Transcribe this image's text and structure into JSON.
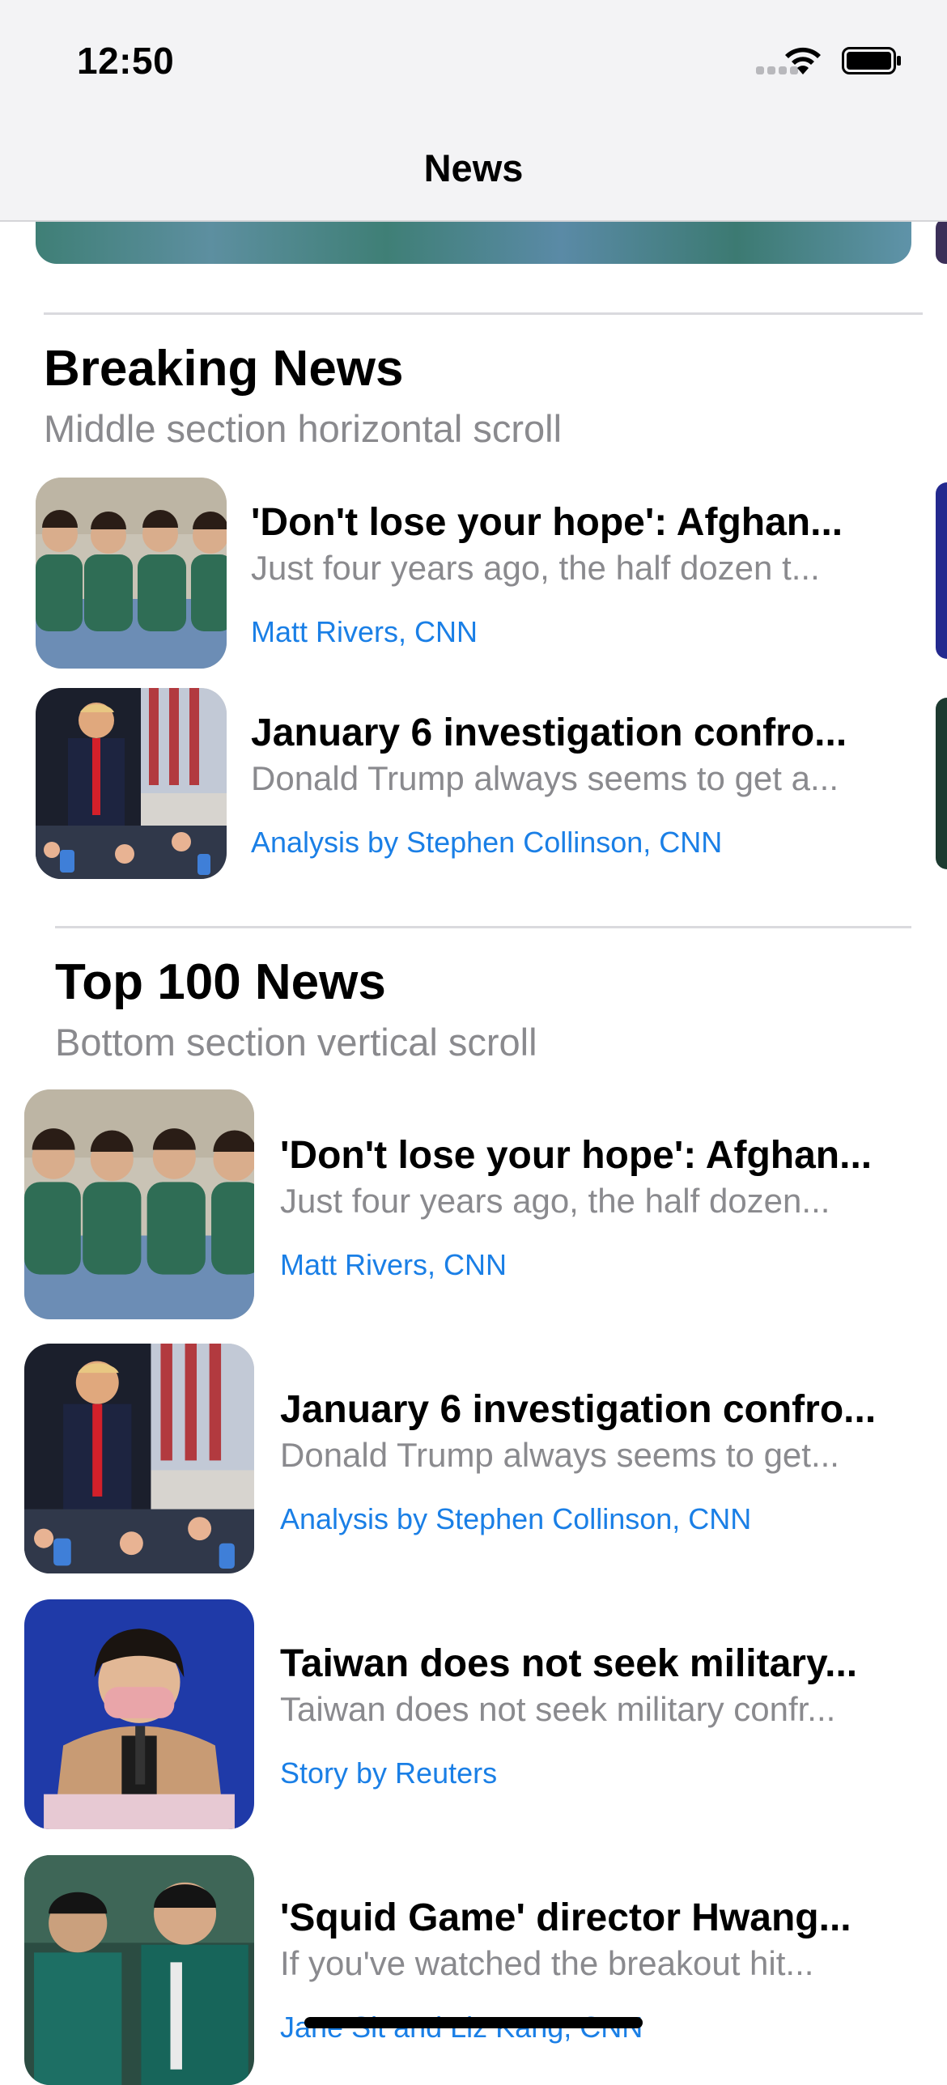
{
  "status_bar": {
    "time": "12:50"
  },
  "nav": {
    "title": "News"
  },
  "breaking": {
    "title": "Breaking News",
    "subtitle": "Middle section horizontal scroll",
    "items": [
      {
        "title": "'Don't lose your hope': Afghan...",
        "description": "Just four years ago, the half dozen t...",
        "author": "Matt Rivers, CNN",
        "image": "afghan-girls-photo"
      },
      {
        "title": "January 6 investigation confro...",
        "description": "Donald Trump always seems to get a...",
        "author": "Analysis by Stephen Collinson, CNN",
        "image": "trump-rally-photo"
      }
    ]
  },
  "top100": {
    "title": "Top 100 News",
    "subtitle": "Bottom section vertical scroll",
    "items": [
      {
        "title": "'Don't lose your hope': Afghan...",
        "description": "Just four years ago, the half dozen...",
        "author": "Matt Rivers, CNN",
        "image": "afghan-girls-photo"
      },
      {
        "title": "January 6 investigation confro...",
        "description": "Donald Trump always seems to get...",
        "author": "Analysis by Stephen Collinson, CNN",
        "image": "trump-rally-photo"
      },
      {
        "title": "Taiwan does not seek military...",
        "description": "Taiwan does not seek military confr...",
        "author": "Story by Reuters",
        "image": "taiwan-president-photo"
      },
      {
        "title": "'Squid Game' director Hwang...",
        "description": "If you've watched the breakout hit...",
        "author": "Jane Sit and Liz Kang, CNN",
        "image": "squid-game-photo"
      }
    ]
  },
  "colors": {
    "accent": "#1a7fe6",
    "secondary_text": "#8a8a8e",
    "divider": "#dadade"
  }
}
